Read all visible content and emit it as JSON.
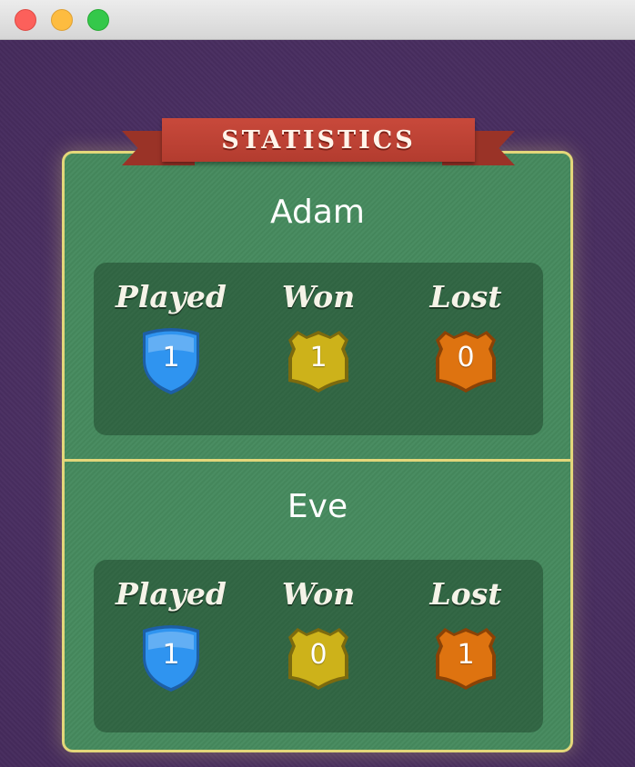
{
  "window": {
    "title": ""
  },
  "banner": {
    "label": "STATISTICS",
    "color": "#c0463a"
  },
  "players": [
    {
      "name": "Adam",
      "stats": {
        "played": {
          "label": "Played",
          "value": "1",
          "color": "#2f94f0"
        },
        "won": {
          "label": "Won",
          "value": "1",
          "color": "#cdb21a"
        },
        "lost": {
          "label": "Lost",
          "value": "0",
          "color": "#de7310"
        }
      }
    },
    {
      "name": "Eve",
      "stats": {
        "played": {
          "label": "Played",
          "value": "1",
          "color": "#2f94f0"
        },
        "won": {
          "label": "Won",
          "value": "0",
          "color": "#cdb21a"
        },
        "lost": {
          "label": "Lost",
          "value": "1",
          "color": "#de7310"
        }
      }
    }
  ],
  "colors": {
    "background": "#4b2e64",
    "board": "#468a5e",
    "board_border": "#e3d77a"
  },
  "icons": {
    "played": "shield-badge-icon",
    "won": "crest-badge-icon",
    "lost": "crest-badge-icon"
  }
}
